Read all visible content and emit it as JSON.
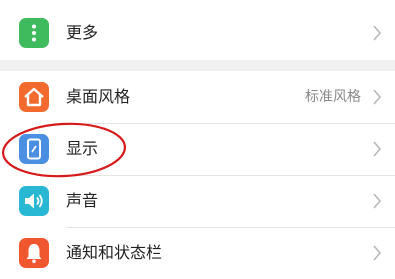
{
  "colors": {
    "more_icon": "#3fba5c",
    "desktop_icon": "#f26a2e",
    "display_icon": "#4a8fe2",
    "sound_icon": "#28b8d4",
    "notification_icon": "#f0572f",
    "annotation_ellipse": "#d61a1a"
  },
  "settings": {
    "more": {
      "label": "更多",
      "icon": "more-dots-icon"
    },
    "desktop_style": {
      "label": "桌面风格",
      "value": "标准风格",
      "icon": "house-icon"
    },
    "display": {
      "label": "显示",
      "icon": "phone-display-icon"
    },
    "sound": {
      "label": "声音",
      "icon": "speaker-icon"
    },
    "notification": {
      "label": "通知和状态栏",
      "icon": "bell-icon"
    }
  }
}
